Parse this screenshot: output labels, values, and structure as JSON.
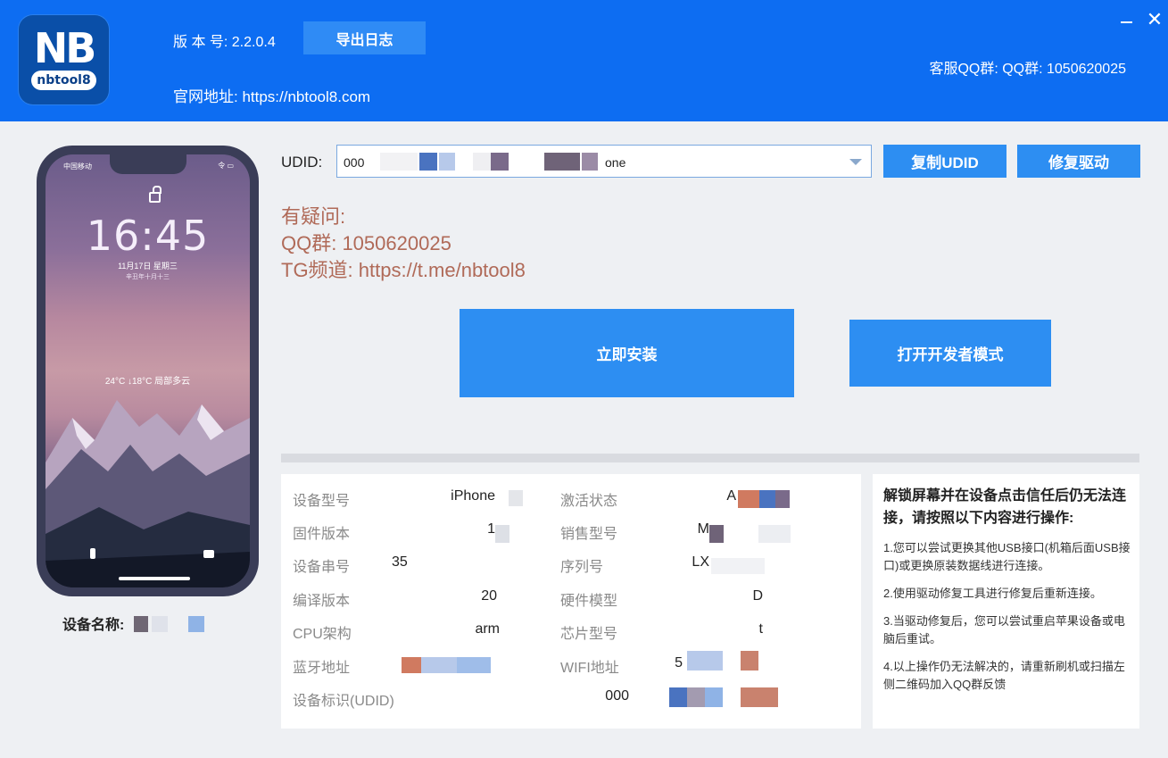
{
  "header": {
    "logo_text": "NB",
    "logo_sub": "nbtool8",
    "version_label": "版 本 号:  2.2.0.4",
    "export_button": "导出日志",
    "site_label": "官网地址:   https://nbtool8.com",
    "qq_label": "客服QQ群:   QQ群:  1050620025"
  },
  "phone": {
    "status_left": "中国移动",
    "status_right": "令 ▭",
    "time": "16:45",
    "date": "11月17日 星期三",
    "lunar": "辛丑年十月十三",
    "weather": "24°C  ↓18°C  局部多云"
  },
  "device_name_label": "设备名称:",
  "udid": {
    "label": "UDID:",
    "value_prefix": "000",
    "value_suffix": "one"
  },
  "buttons": {
    "copy_udid": "复制UDID",
    "fix_driver": "修复驱动",
    "install": "立即安装",
    "dev_mode": "打开开发者模式"
  },
  "help": {
    "line1": "有疑问:",
    "line2": "QQ群:  1050620025",
    "line3": "TG频道:  https://t.me/nbtool8"
  },
  "info": {
    "device_model_label": "设备型号",
    "device_model_value": "iPhone",
    "activation_label": "激活状态",
    "activation_value": "A",
    "firmware_label": "固件版本",
    "firmware_value": "1",
    "sales_model_label": "销售型号",
    "sales_model_value": "M",
    "serial_label": "设备串号",
    "serial_value": "35",
    "seq_label": "序列号",
    "seq_value": "LX",
    "build_label": "编译版本",
    "build_value": "20",
    "hw_model_label": "硬件模型",
    "hw_model_value": "D",
    "cpu_label": "CPU架构",
    "cpu_value": "arm",
    "chip_label": "芯片型号",
    "chip_value": "t",
    "bt_label": "蓝牙地址",
    "wifi_label": "WIFI地址",
    "wifi_value": "5",
    "udid_label": "设备标识(UDID)",
    "udid_value": "000"
  },
  "notice": {
    "title": "解锁屏幕并在设备点击信任后仍无法连接，请按照以下内容进行操作:",
    "items": [
      "1.您可以尝试更换其他USB接口(机箱后面USB接口)或更换原装数据线进行连接。",
      "2.使用驱动修复工具进行修复后重新连接。",
      "3.当驱动修复后，您可以尝试重启苹果设备或电脑后重试。",
      "4.以上操作仍无法解决的，请重新刷机或扫描左侧二维码加入QQ群反馈"
    ]
  },
  "colors": {
    "header_blue": "#0d6df2",
    "button_blue": "#2d8ef2",
    "help_text": "#b06a58"
  }
}
